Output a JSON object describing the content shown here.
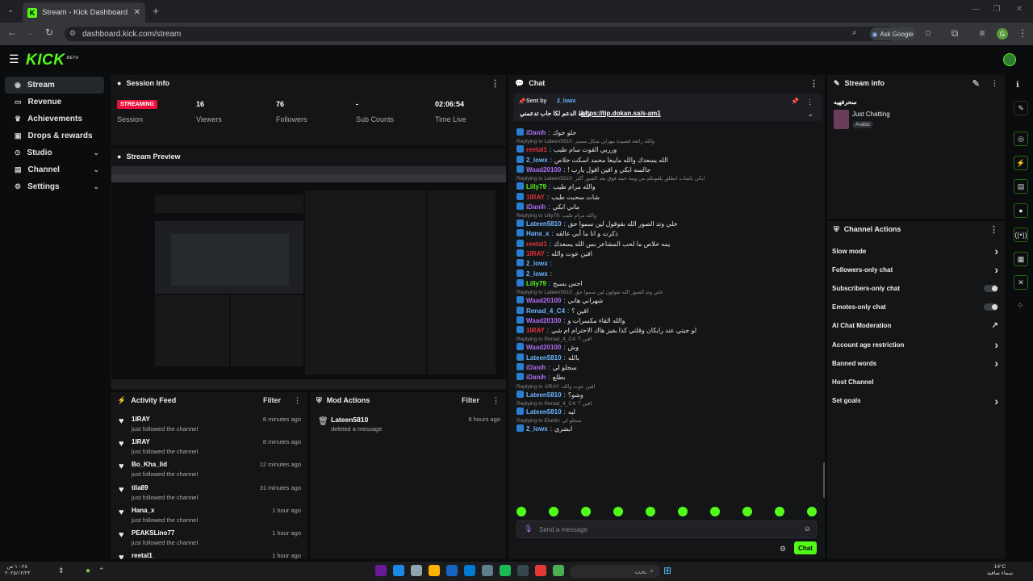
{
  "browser": {
    "tab_title": "Stream - Kick Dashboard",
    "url": "dashboard.kick.com/stream",
    "ask_google": "Ask Google",
    "profile_initial": "G"
  },
  "app": {
    "logo": "KICK",
    "logo_beta": "BETA"
  },
  "nav": {
    "items": [
      {
        "label": "Stream",
        "icon": "stream-icon",
        "active": true,
        "chevron": false
      },
      {
        "label": "Revenue",
        "icon": "revenue-icon",
        "chevron": false
      },
      {
        "label": "Achievements",
        "icon": "achievements-icon",
        "chevron": false
      },
      {
        "label": "Drops & rewards",
        "icon": "drops-icon",
        "chevron": false
      },
      {
        "label": "Studio",
        "icon": "studio-icon",
        "chevron": true
      },
      {
        "label": "Channel",
        "icon": "channel-icon",
        "chevron": true
      },
      {
        "label": "Settings",
        "icon": "settings-icon",
        "chevron": true
      }
    ]
  },
  "session": {
    "title": "Session Info",
    "status": "STREAMING",
    "status_label": "Session",
    "viewers": "16",
    "viewers_label": "Viewers",
    "followers": "76",
    "followers_label": "Followers",
    "sub_counts": "-",
    "sub_counts_label": "Sub Counts",
    "time_live": "02:06:54",
    "time_live_label": "Time Live"
  },
  "preview": {
    "title": "Stream Preview"
  },
  "activity": {
    "title": "Activity Feed",
    "filter": "Filter",
    "items": [
      {
        "name": "1IRAY",
        "action": "just followed the channel",
        "time": "8 minutes ago"
      },
      {
        "name": "1IRAY",
        "action": "just followed the channel",
        "time": "8 minutes ago"
      },
      {
        "name": "Bo_Kha_lid",
        "action": "just followed the channel",
        "time": "12 minutes ago"
      },
      {
        "name": "tila89",
        "action": "just followed the channel",
        "time": "31 minutes ago"
      },
      {
        "name": "Hana_x",
        "action": "just followed the channel",
        "time": "1 hour ago"
      },
      {
        "name": "PEAKSLino77",
        "action": "just followed the channel",
        "time": "1 hour ago"
      },
      {
        "name": "reetal1",
        "action": "",
        "time": "1 hour ago"
      }
    ]
  },
  "mod": {
    "title": "Mod Actions",
    "filter": "Filter",
    "items": [
      {
        "name": "Lateen5810",
        "action": "deleted a message",
        "time": "8 hours ago"
      }
    ]
  },
  "chat": {
    "title": "Chat",
    "pinned_by_label": "Sent by",
    "pinned_by": "2_lowx",
    "pinned_text": "رابط الدعم لكا حاب تدعمني",
    "pinned_link": "https://tip.dokan.sa/s-am1",
    "messages": [
      {
        "user": "iDanih",
        "color": "#b06cf0",
        "text": "حلو جوك"
      },
      {
        "reply": "Replying to Lateen5810: والله رائعة قصيدة مهزلي شكل مستر"
      },
      {
        "user": "reetal1",
        "color": "#e0343a",
        "text": "ورربي القوت سام طيب"
      },
      {
        "user": "2_lowx",
        "color": "#6cb6ff",
        "text": "الله يسعدك والله مايبغا محمد اسكت خلاص"
      },
      {
        "user": "Waad20100",
        "color": "#b06cf0",
        "text": "! جالسه ابكي و اقين اقول يارب"
      },
      {
        "reply": "Replying to Lateen5810: ابكي ياشات انطلق بلعونكم من وتبة حمد فوق بعد الصور أكثر"
      },
      {
        "user": "Lilly79",
        "color": "#53fc18",
        "text": "والله مرام طيب"
      },
      {
        "user": "1IRAY",
        "color": "#e0343a",
        "text": "شات سحبت طيب"
      },
      {
        "user": "iDanih",
        "color": "#b06cf0",
        "text": "ماني ابكي"
      },
      {
        "reply": "Replying to Lilly79: والله مرام طيب"
      },
      {
        "user": "Lateen5810",
        "color": "#6cb6ff",
        "text": "خلي وتد الصور الله بقوقول لين سموا حق"
      },
      {
        "user": "Hana_x",
        "color": "#6cb6ff",
        "text": "ذكرت و انا ما أبي عالقه"
      },
      {
        "user": "reetal1",
        "color": "#e0343a",
        "text": "يمه خلاص ما لحب المشاعر بس الله يسعدك"
      },
      {
        "user": "1IRAY",
        "color": "#e0343a",
        "text": "اقين عوت والله"
      },
      {
        "user": "2_lowx",
        "color": "#6cb6ff",
        "text": ""
      },
      {
        "user": "2_lowx",
        "color": "#6cb6ff",
        "text": ""
      },
      {
        "user": "Lilly79",
        "color": "#53fc18",
        "text": "احس بسبح"
      },
      {
        "reply": "Replying to Lateen5810: خلي وتد الصور الله تقولون لين سموا حق"
      },
      {
        "user": "Waad20100",
        "color": "#b06cf0",
        "text": "شهراني هاني"
      },
      {
        "user": "Renad_4_C4",
        "color": "#6cb6ff",
        "text": "اقين ؟"
      },
      {
        "user": "Waad20100",
        "color": "#b06cf0",
        "text": "والله القاء مكسرات و"
      },
      {
        "user": "1IRAY",
        "color": "#e0343a",
        "text": "لو جيتي عند رابكان وقلتي كذا بفيز هاك الاحترام ام شي"
      },
      {
        "reply": "Replying to Renad_4_C4: اقين ؟"
      },
      {
        "user": "Waad20100",
        "color": "#b06cf0",
        "text": "وش"
      },
      {
        "user": "Lateen5810",
        "color": "#6cb6ff",
        "text": "بالله"
      },
      {
        "user": "iDanih",
        "color": "#b06cf0",
        "text": "سجلو لي"
      },
      {
        "user": "iDanih",
        "color": "#b06cf0",
        "text": "بطلع"
      },
      {
        "reply": "Replying to 1IRAY: اقين عوت والله"
      },
      {
        "user": "Lateen5810",
        "color": "#6cb6ff",
        "text": "وشو؟"
      },
      {
        "reply": "Replying to Renad_4_C4: اقين ؟"
      },
      {
        "user": "Lateen5810",
        "color": "#6cb6ff",
        "text": "ليه"
      },
      {
        "reply": "Replying to iDanih: سجلو لي"
      },
      {
        "user": "2_lowx",
        "color": "#6cb6ff",
        "text": "ابشري"
      }
    ],
    "input_placeholder": "Send a message",
    "send_label": "Chat"
  },
  "stream_info": {
    "title": "Stream info",
    "stream_title": "سحرفهيه",
    "category": "Just Chatting",
    "language": "Arabic"
  },
  "channel_actions": {
    "title": "Channel Actions",
    "items": [
      {
        "label": "Slow mode",
        "control": "arrow"
      },
      {
        "label": "Followers-only chat",
        "control": "arrow"
      },
      {
        "label": "Subscribers-only chat",
        "control": "toggle"
      },
      {
        "label": "Emotes-only chat",
        "control": "toggle"
      },
      {
        "label": "AI Chat Moderation",
        "control": "external"
      },
      {
        "label": "Account age restriction",
        "control": "arrow"
      },
      {
        "label": "Banned words",
        "control": "arrow"
      },
      {
        "label": "Host Channel",
        "control": "none"
      },
      {
        "label": "Set goals",
        "control": "arrow"
      }
    ]
  },
  "taskbar": {
    "weather": "14°C",
    "weather_desc": "سماء صافية",
    "time": "١٠:٢٨ ص",
    "date": "٢٠٢٥/١٢/٢٢",
    "search_label": "بحث"
  },
  "colors": {
    "accent": "#53fc18",
    "live": "#e9113c",
    "panel": "#141517"
  }
}
